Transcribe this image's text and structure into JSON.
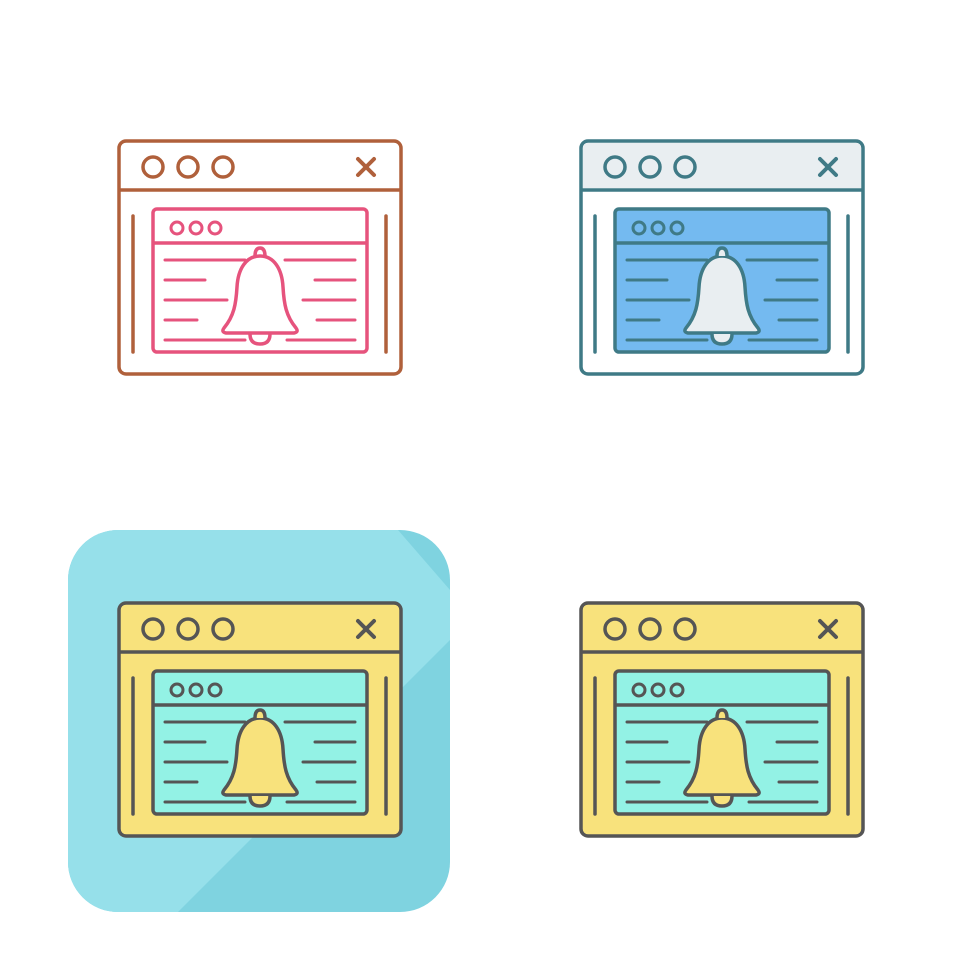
{
  "icon_set": {
    "subject": "browser-notification",
    "variants": [
      {
        "style": "line",
        "tile": false,
        "colors": {
          "outer_stroke": "#b0603b",
          "outer_fill": "none",
          "outer_header_fill": "none",
          "inner_stroke": "#e6537d",
          "inner_fill": "none",
          "bell_stroke": "#e6537d",
          "bell_fill": "none"
        }
      },
      {
        "style": "filled-line",
        "tile": false,
        "colors": {
          "outer_stroke": "#3f7a86",
          "outer_fill": "#ffffff",
          "outer_header_fill": "#e9eef1",
          "inner_stroke": "#3f7a86",
          "inner_fill": "#74baf0",
          "bell_stroke": "#3f7a86",
          "bell_fill": "#e9eef1"
        }
      },
      {
        "style": "filled-line-on-tile",
        "tile": true,
        "tile_colors": {
          "base": "#7fd3e0",
          "highlight": "#96e0ea"
        },
        "colors": {
          "outer_stroke": "#555555",
          "outer_fill": "#f8e27c",
          "outer_header_fill": "#f8e27c",
          "inner_stroke": "#555555",
          "inner_fill": "#93f2e5",
          "bell_stroke": "#555555",
          "bell_fill": "#f8e27c"
        }
      },
      {
        "style": "filled-line",
        "tile": false,
        "colors": {
          "outer_stroke": "#555555",
          "outer_fill": "#f8e27c",
          "outer_header_fill": "#f8e27c",
          "inner_stroke": "#555555",
          "inner_fill": "#93f2e5",
          "bell_stroke": "#555555",
          "bell_fill": "#f8e27c"
        }
      }
    ]
  }
}
